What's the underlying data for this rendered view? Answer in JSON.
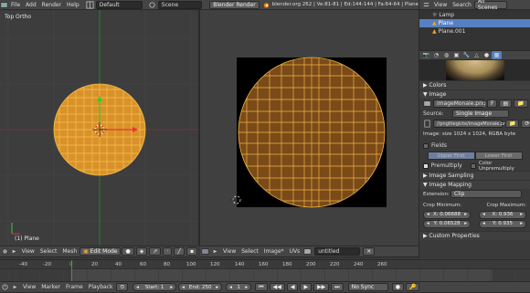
{
  "top_bar": {
    "menus": [
      "File",
      "Add",
      "Render",
      "Help"
    ],
    "layout": "Default",
    "scene": "Scene",
    "engine": "Blender Render",
    "stats": "blender.org 262 | Ve:81-81 | Ed:144-144 | Fa:64-64 | Plane"
  },
  "viewport3d": {
    "title": "Top Ortho",
    "object_label": "(1) Plane",
    "header": {
      "menus": [
        "View",
        "Select",
        "Mesh"
      ],
      "mode": "Edit Mode"
    }
  },
  "uv_editor": {
    "header": {
      "menus": [
        "View",
        "Select",
        "Image*",
        "UVs"
      ],
      "image_name": "untitled"
    }
  },
  "outliner": {
    "tabs": [
      "View",
      "Search",
      "All Scenes"
    ],
    "items": [
      "Lamp",
      "Plane",
      "Plane.001"
    ]
  },
  "properties": {
    "sections": {
      "colors": "Colors",
      "image": "Image",
      "fields": "Fields",
      "image_sampling": "Image Sampling",
      "image_mapping": "Image Mapping",
      "custom_properties": "Custom Properties"
    },
    "image_name": "imageMonaie.png",
    "image_btn_f": "F",
    "source_label": "Source:",
    "source_value": "Single Image",
    "filepath": "//pngtilegicte/imageMonaie.png",
    "image_info": "Image: size 1024 x 1024, RGBA byte",
    "upper_first": "Upper First",
    "lower_first": "Lower First",
    "premultiply": "Premultiply",
    "color_unpremultiply": "Color Unpremultiply",
    "extension_label": "Extension:",
    "extension_value": "Clip",
    "crop_min_label": "Crop Minimum:",
    "crop_max_label": "Crop Maximum:",
    "crop_min_x": "X: 0.06688",
    "crop_min_y": "Y: 0.06528",
    "crop_max_x": "X: 0.936",
    "crop_max_y": "Y: 0.935"
  },
  "timeline": {
    "ticks": [
      "-40",
      "-20",
      "0",
      "20",
      "40",
      "60",
      "80",
      "100",
      "120",
      "140",
      "160",
      "180",
      "200",
      "220",
      "240",
      "260"
    ],
    "menus": [
      "View",
      "Marker",
      "Frame",
      "Playback"
    ],
    "start": "Start: 1",
    "end": "End: 250",
    "current": "1",
    "sync": "No Sync"
  },
  "colors": {
    "mesh_fill": "#d9922b",
    "mesh_edge": "#f5c04a",
    "uv_fill": "#7a4a18",
    "selected_blue": "#5680c2"
  }
}
